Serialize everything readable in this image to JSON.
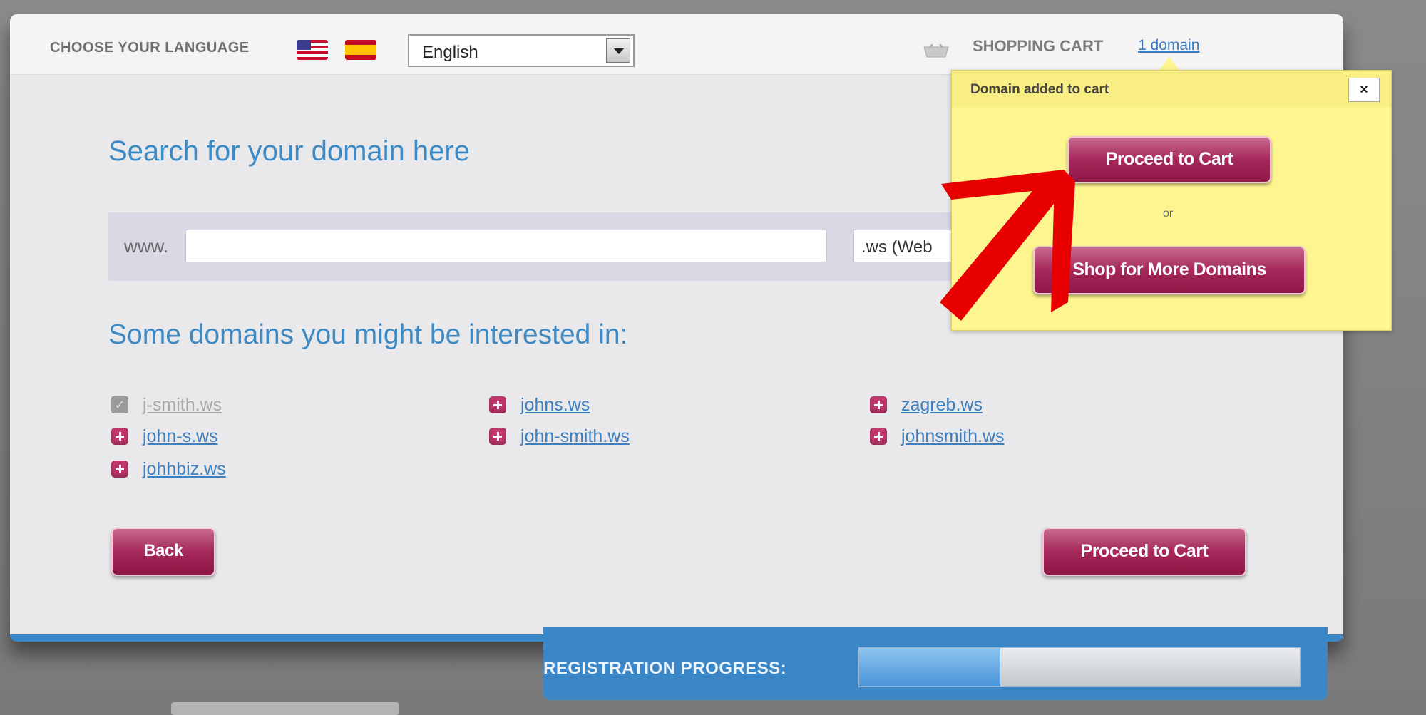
{
  "header": {
    "language_label": "CHOOSE YOUR LANGUAGE",
    "language_value": "English",
    "cart_label": "SHOPPING CART",
    "cart_link": "1 domain"
  },
  "search": {
    "title": "Search for your domain here",
    "prefix": "www.",
    "input_value": "",
    "tld_value": ".ws (Web"
  },
  "suggestions": {
    "title": "Some domains you might be interested in:",
    "items": [
      {
        "name": "j-smith.ws",
        "added": true
      },
      {
        "name": "johns.ws",
        "added": false
      },
      {
        "name": "zagreb.ws",
        "added": false
      },
      {
        "name": "john-s.ws",
        "added": false
      },
      {
        "name": "john-smith.ws",
        "added": false
      },
      {
        "name": "johnsmith.ws",
        "added": false
      },
      {
        "name": "johhbiz.ws",
        "added": false
      }
    ]
  },
  "buttons": {
    "back": "Back",
    "proceed": "Proceed to Cart"
  },
  "progress": {
    "label": "REGISTRATION PROGRESS:",
    "value": 0.32
  },
  "popup": {
    "title": "Domain added to cart",
    "close": "×",
    "proceed": "Proceed to Cart",
    "or": "or",
    "shop_more": "Shop for More Domains"
  },
  "colors": {
    "accent_blue": "#3a86c6",
    "button_magenta": "#a5285a",
    "popup_yellow": "#fdf58f",
    "arrow_red": "#e80000"
  },
  "icons": [
    "us-flag-icon",
    "spain-flag-icon",
    "dropdown-arrow-icon",
    "shopping-cart-icon",
    "add-domain-icon",
    "checked-icon",
    "close-icon",
    "red-arrow-annotation"
  ]
}
